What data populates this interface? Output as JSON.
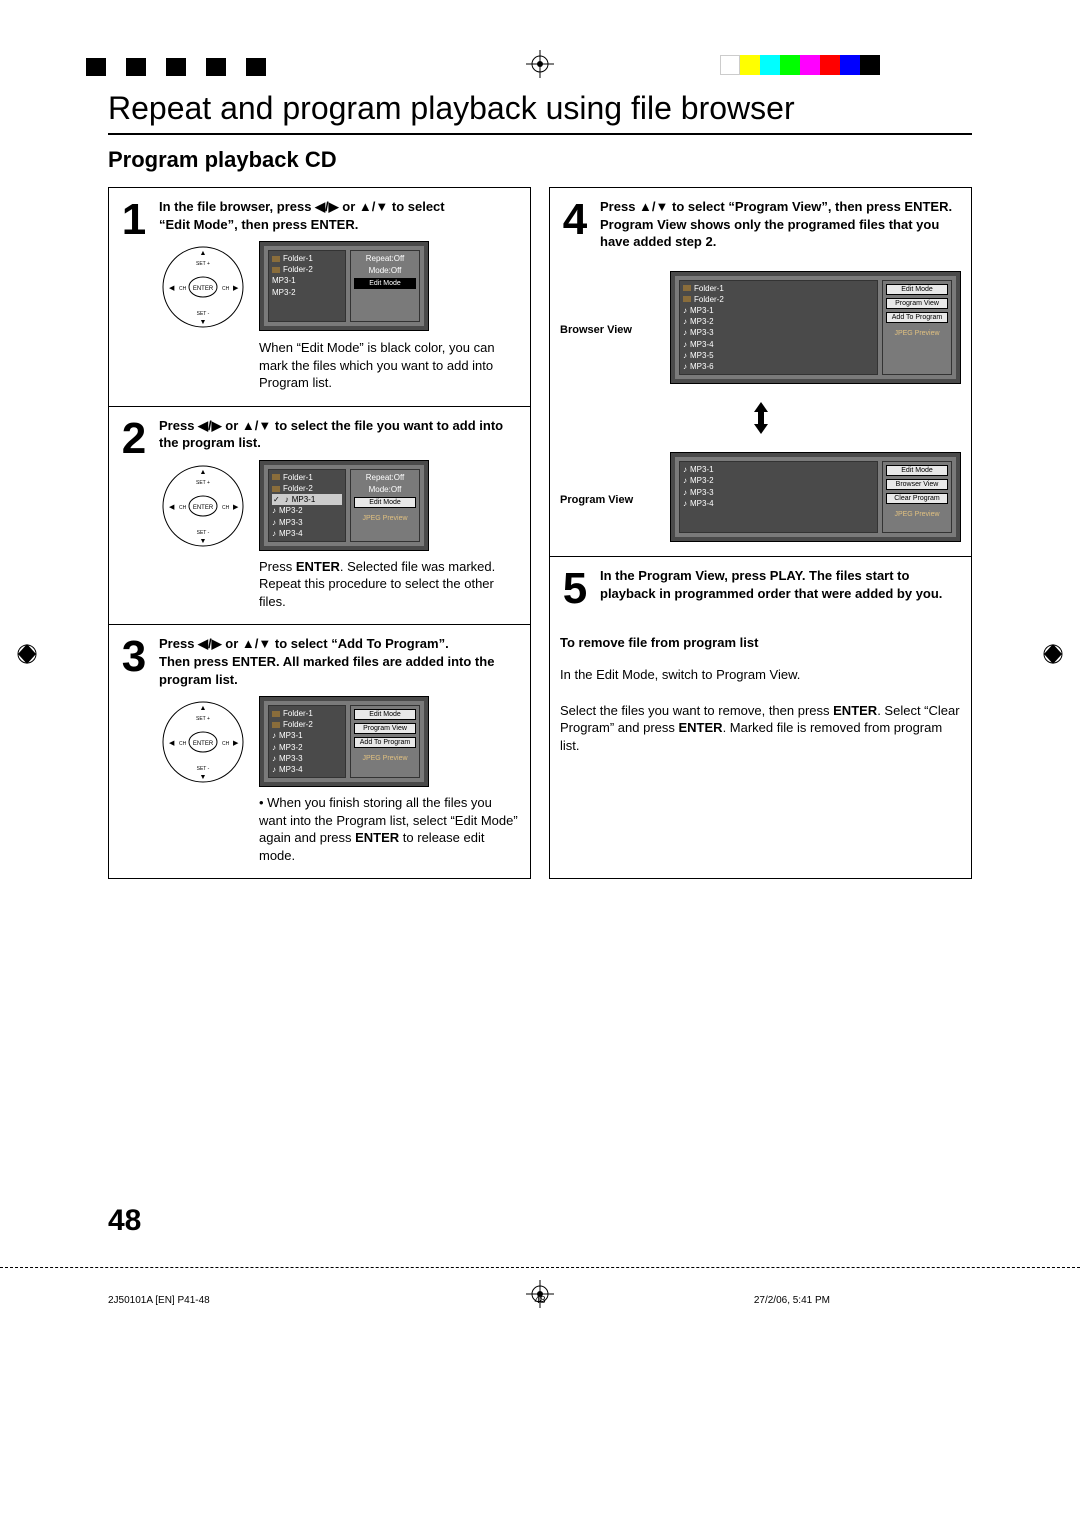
{
  "regbar": {
    "colors2": [
      "#fff",
      "#ff0",
      "#0ff",
      "#0f0",
      "#f0f",
      "#f00",
      "#00f",
      "#000"
    ]
  },
  "title": "Repeat and program playback using file browser",
  "section": "Program playback CD",
  "arrows": {
    "lr": "◀/▶",
    "ud": "▲/▼"
  },
  "steps": {
    "s1": {
      "num": "1",
      "text_pre": "In the file browser, press ",
      "text_mid": " or ",
      "text_post": " to select",
      "text_line2": "“Edit Mode”, then press ENTER.",
      "desc": "When “Edit Mode” is black color, you can mark the files which you want to add into Program list.",
      "files": [
        "Folder-1",
        "Folder-2",
        "MP3-1",
        "MP3-2"
      ],
      "right": {
        "repeat": "Repeat",
        "repeat_v": ":Off",
        "mode": "Mode",
        "mode_v": ":Off",
        "edit": "Edit Mode"
      }
    },
    "s2": {
      "num": "2",
      "text_pre": "Press ",
      "text_mid": " or ",
      "text_post": " to select the file you want to add into the program list.",
      "desc_pre": "Press ",
      "desc_enter": "ENTER",
      "desc_post": ". Selected file was marked.",
      "desc2": "Repeat this procedure to select the other files.",
      "files": [
        "Folder-1",
        "Folder-2",
        "MP3-1",
        "MP3-2",
        "MP3-3",
        "MP3-4"
      ],
      "jpeg": "JPEG Preview"
    },
    "s3": {
      "num": "3",
      "text_pre": "Press ",
      "text_mid": " or ",
      "text_post": " to select “Add To Program”.",
      "line2": "Then press ENTER. All marked files are added into the program list.",
      "desc_pre": "• When you finish storing all the files you want into the Program list, select “Edit Mode” again and press ",
      "desc_enter": "ENTER",
      "desc_post": " to release edit mode.",
      "files": [
        "Folder-1",
        "Folder-2",
        "MP3-1",
        "MP3-2",
        "MP3-3",
        "MP3-4"
      ],
      "right": {
        "em": "Edit Mode",
        "pv": "Program View",
        "add": "Add To Program",
        "jpeg": "JPEG Preview"
      }
    },
    "s4": {
      "num": "4",
      "text_pre": "Press ",
      "text_post": " to select “Program View”, then press ENTER. Program View shows only the programed files that you have added step 2.",
      "bv": {
        "label": "Browser View",
        "files": [
          "Folder-1",
          "Folder-2",
          "MP3-1",
          "MP3-2",
          "MP3-3",
          "MP3-4",
          "MP3-5",
          "MP3-6"
        ],
        "right": {
          "em": "Edit Mode",
          "pv": "Program View",
          "add": "Add To Program",
          "jpeg": "JPEG Preview"
        }
      },
      "pv": {
        "label": "Program View",
        "files": [
          "MP3-1",
          "MP3-2",
          "MP3-3",
          "MP3-4"
        ],
        "right": {
          "em": "Edit Mode",
          "bv": "Browser View",
          "cp": "Clear Program",
          "jpeg": "JPEG Preview"
        }
      }
    },
    "s5": {
      "num": "5",
      "text": "In the Program View, press PLAY. The files start to playback in programmed order that were added by you."
    },
    "remove": {
      "head": "To remove file from program list",
      "p1": "In the Edit Mode, switch to Program View.",
      "p2_pre": "Select the files you want to remove, then press ",
      "p2_e1": "ENTER",
      "p2_mid": ". Select “Clear Program” and press ",
      "p2_e2": "ENTER",
      "p2_post": ". Marked file is removed from program list."
    }
  },
  "footer": {
    "left": "2J50101A [EN] P41-48",
    "center": "48",
    "right": "27/2/06, 5:41 PM"
  },
  "pageno": "48"
}
